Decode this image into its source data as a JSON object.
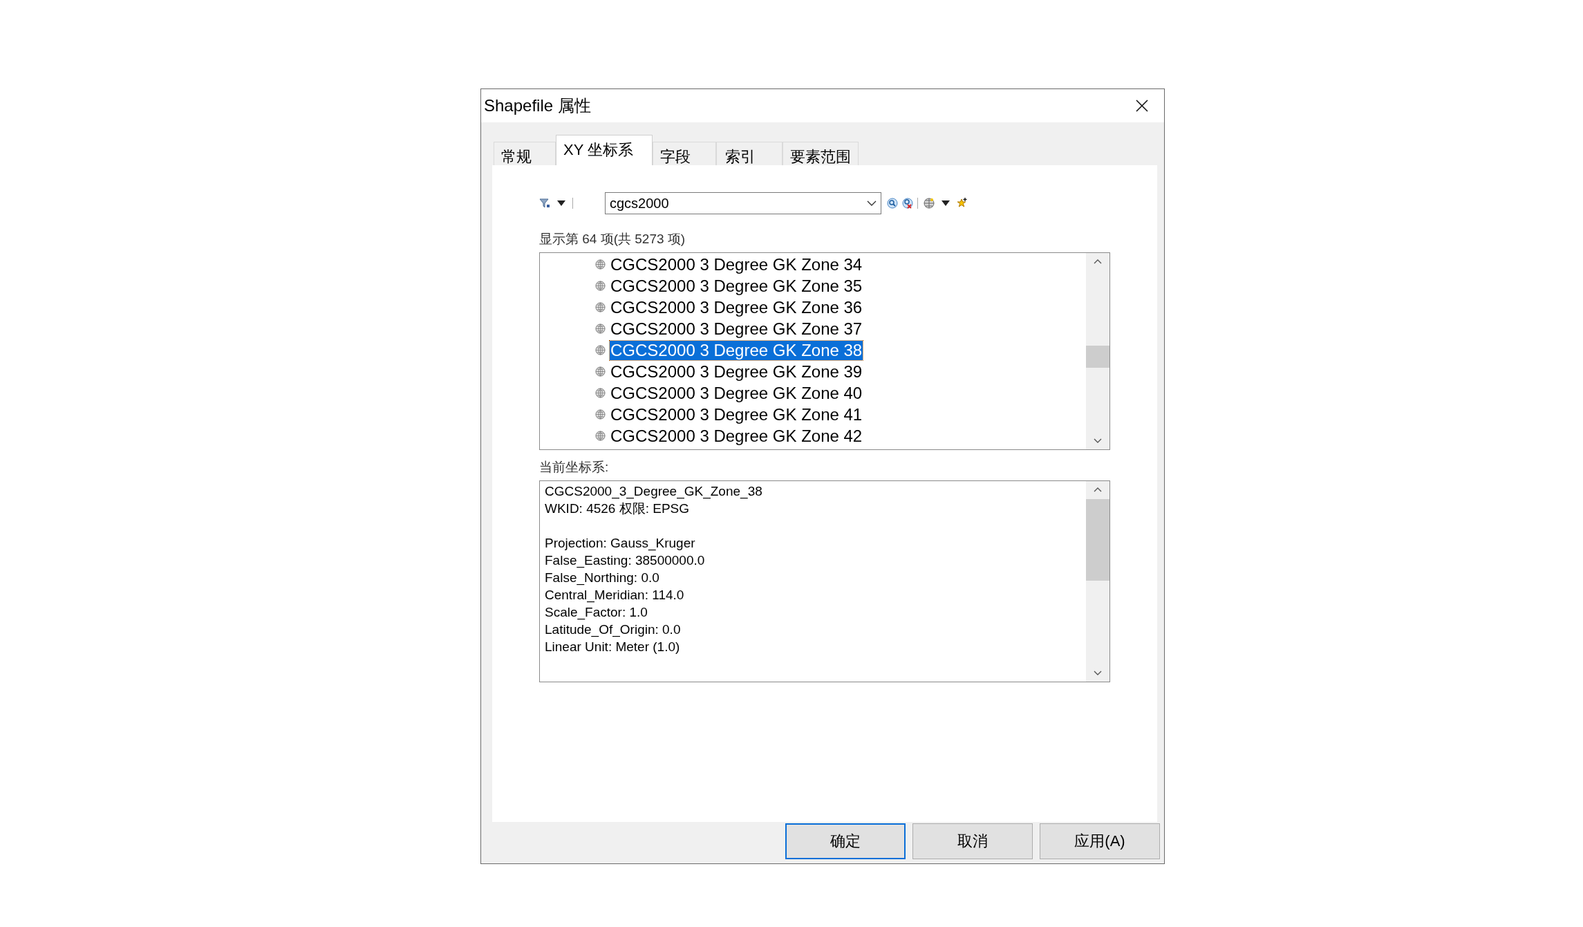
{
  "window": {
    "title": "Shapefile 属性"
  },
  "tabs": [
    {
      "label": "常规",
      "selected": false
    },
    {
      "label": "XY 坐标系",
      "selected": true
    },
    {
      "label": "字段",
      "selected": false
    },
    {
      "label": "索引",
      "selected": false
    },
    {
      "label": "要素范围",
      "selected": false
    }
  ],
  "search": {
    "value": "cgcs2000"
  },
  "list_label": "显示第 64 项(共 5273 项)",
  "list": [
    {
      "label": "CGCS2000 3 Degree GK Zone 34",
      "selected": false
    },
    {
      "label": "CGCS2000 3 Degree GK Zone 35",
      "selected": false
    },
    {
      "label": "CGCS2000 3 Degree GK Zone 36",
      "selected": false
    },
    {
      "label": "CGCS2000 3 Degree GK Zone 37",
      "selected": false
    },
    {
      "label": "CGCS2000 3 Degree GK Zone 38",
      "selected": true
    },
    {
      "label": "CGCS2000 3 Degree GK Zone 39",
      "selected": false
    },
    {
      "label": "CGCS2000 3 Degree GK Zone 40",
      "selected": false
    },
    {
      "label": "CGCS2000 3 Degree GK Zone 41",
      "selected": false
    },
    {
      "label": "CGCS2000 3 Degree GK Zone 42",
      "selected": false
    }
  ],
  "current_label": "当前坐标系:",
  "details": [
    {
      "lines": [
        "CGCS2000_3_Degree_GK_Zone_38",
        "WKID: 4526 权限: EPSG"
      ]
    },
    {
      "lines": [
        "Projection: Gauss_Kruger",
        "False_Easting: 38500000.0",
        "False_Northing: 0.0",
        "Central_Meridian: 114.0",
        "Scale_Factor: 1.0",
        "Latitude_Of_Origin: 0.0",
        "Linear Unit: Meter (1.0)"
      ]
    }
  ],
  "buttons": [
    {
      "label": "确定",
      "default": true
    },
    {
      "label": "取消",
      "default": false
    },
    {
      "label": "应用(A)",
      "default": false
    }
  ]
}
